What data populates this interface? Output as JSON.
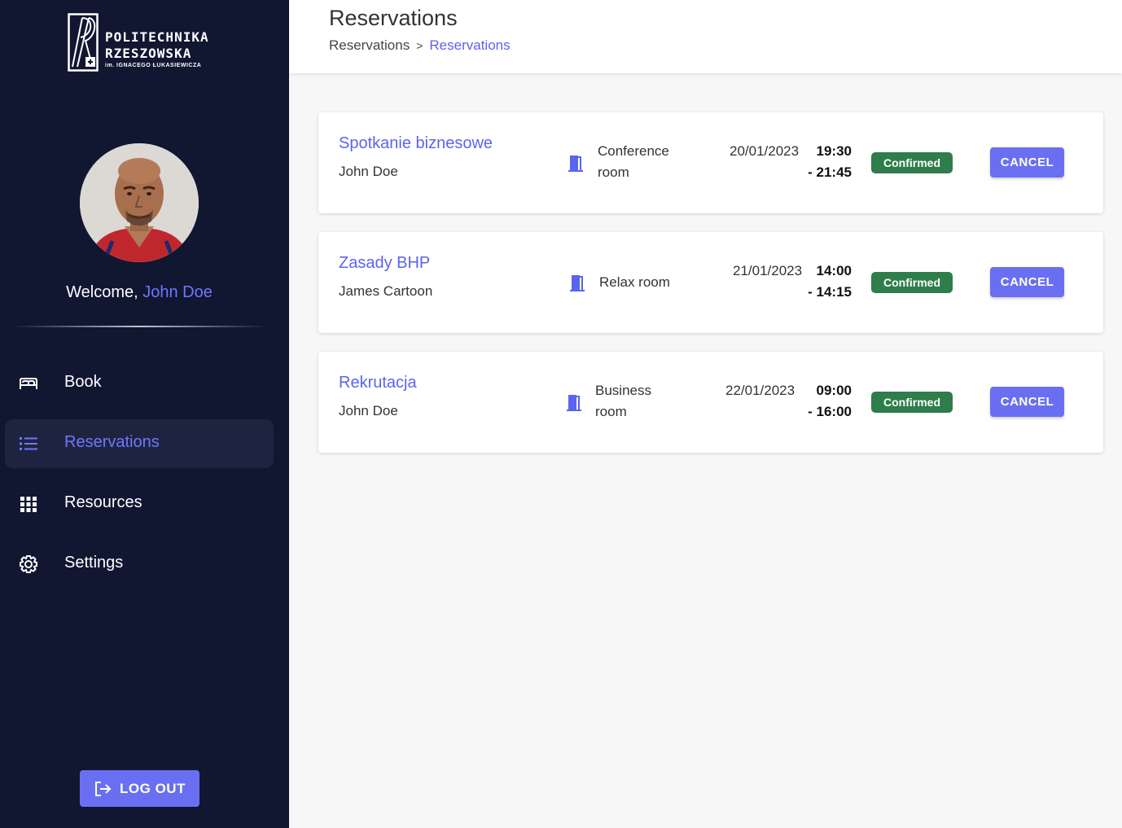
{
  "brand": {
    "line1": "POLITECHNIKA",
    "line2": "RZESZOWSKA",
    "line3": "im. IGNACEGO ŁUKASIEWICZA"
  },
  "user": {
    "welcome": "Welcome,",
    "name": "John Doe"
  },
  "nav": [
    {
      "label": "Book",
      "icon": "bed-icon",
      "active": false
    },
    {
      "label": "Reservations",
      "icon": "list-icon",
      "active": true
    },
    {
      "label": "Resources",
      "icon": "grid-icon",
      "active": false
    },
    {
      "label": "Settings",
      "icon": "gear-icon",
      "active": false
    }
  ],
  "logout_label": "LOG OUT",
  "header": {
    "title": "Reservations",
    "breadcrumb": [
      "Reservations",
      "Reservations"
    ]
  },
  "reservations": [
    {
      "title": "Spotkanie biznesowe",
      "owner": "John Doe",
      "room": "Conference room",
      "date": "20/01/2023",
      "start": "19:30",
      "end": "- 21:45",
      "status": "Confirmed",
      "action": "CANCEL"
    },
    {
      "title": "Zasady BHP",
      "owner": "James Cartoon",
      "room": "Relax room",
      "date": "21/01/2023",
      "start": "14:00",
      "end": "- 14:15",
      "status": "Confirmed",
      "action": "CANCEL"
    },
    {
      "title": "Rekrutacja",
      "owner": "John Doe",
      "room": "Business room",
      "date": "22/01/2023",
      "start": "09:00",
      "end": "- 16:00",
      "status": "Confirmed",
      "action": "CANCEL"
    }
  ],
  "colors": {
    "sidebar": "#111631",
    "accent": "#6a6ff2",
    "link": "#5a64f0",
    "confirmed": "#2e7d4a"
  }
}
